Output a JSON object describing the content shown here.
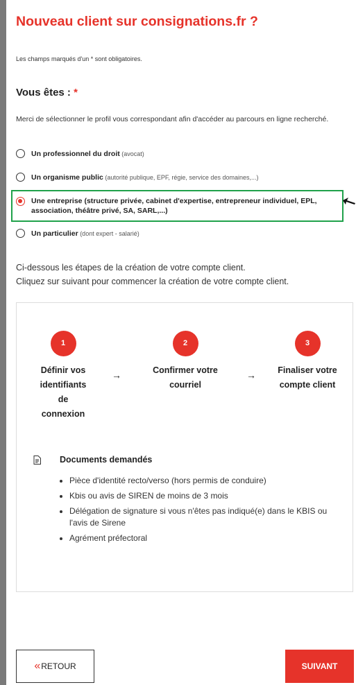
{
  "page": {
    "title": "Nouveau client sur consignations.fr ?",
    "required_note": "Les champs marqués d'un * sont obligatoires."
  },
  "profile": {
    "label": "Vous êtes :",
    "required_mark": "*",
    "intro": "Merci de sélectionner le profil vous correspondant afin d'accéder au parcours en ligne recherché.",
    "options": [
      {
        "strong": "Un professionnel du droit",
        "light": " (avocat)",
        "selected": false
      },
      {
        "strong": "Un organisme public",
        "light": " (autorité publique, EPF, régie, service des domaines,...)",
        "selected": false
      },
      {
        "strong": "Une entreprise (structure privée, cabinet d'expertise, entrepreneur individuel, EPL, association, théâtre privé, SA, SARL,...)",
        "light": "",
        "selected": true
      },
      {
        "strong": "Un particulier",
        "light": " (dont expert - salarié)",
        "selected": false
      }
    ],
    "selected_index": 2
  },
  "info": {
    "line1": "Ci-dessous les étapes de la création de votre compte client.",
    "line2": "Cliquez sur suivant pour commencer la création de votre compte client."
  },
  "steps": [
    {
      "number": "1",
      "label": "Définir vos identifiants de connexion"
    },
    {
      "number": "2",
      "label": "Confirmer votre courriel"
    },
    {
      "number": "3",
      "label": "Finaliser votre compte client"
    }
  ],
  "step_arrow": "→",
  "documents": {
    "title": "Documents demandés",
    "items": [
      "Pièce d'identité recto/verso (hors permis de conduire)",
      "Kbis ou avis de SIREN de moins de 3 mois",
      "Délégation de signature si vous n'êtes pas indiqué(e) dans le KBIS ou l'avis de Sirene",
      "Agrément préfectoral"
    ]
  },
  "buttons": {
    "back_chevron": "«",
    "back": "RETOUR",
    "next": "SUIVANT"
  },
  "colors": {
    "accent": "#e6332a",
    "highlight": "#1fa14a"
  },
  "icons": {
    "pointer": "arrow-pointer-icon",
    "document": "document-icon"
  }
}
